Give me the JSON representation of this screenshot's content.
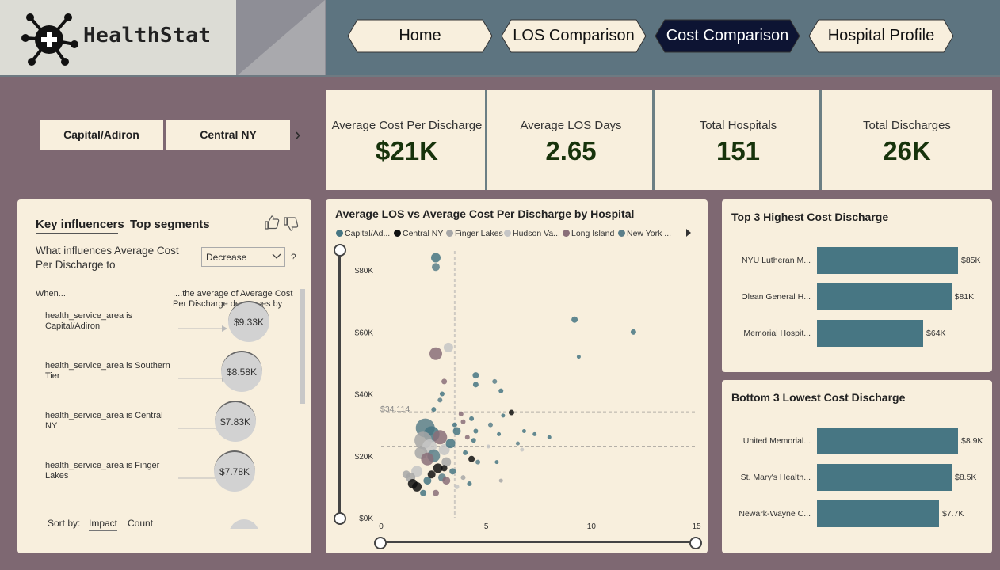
{
  "app": {
    "name": "HealthStat"
  },
  "nav": [
    {
      "label": "Home",
      "active": false
    },
    {
      "label": "LOS Comparison",
      "active": false
    },
    {
      "label": "Cost Comparison",
      "active": true
    },
    {
      "label": "Hospital Profile",
      "active": false
    }
  ],
  "slicer": {
    "items": [
      "Capital/Adiron",
      "Central NY"
    ],
    "next": "›"
  },
  "kpis": [
    {
      "label": "Average Cost Per Discharge",
      "value": "$21K"
    },
    {
      "label": "Average LOS Days",
      "value": "2.65"
    },
    {
      "label": "Total Hospitals",
      "value": "151"
    },
    {
      "label": "Total Discharges",
      "value": "26K"
    }
  ],
  "influencers": {
    "tabs": [
      "Key influencers",
      "Top segments"
    ],
    "question": "What influences Average Cost Per Discharge to",
    "dropdown": "Decrease",
    "help": "?",
    "col_when": "When...",
    "col_effect": "....the average of Average Cost Per Discharge decreases by",
    "items": [
      {
        "condition": "health_service_area is Capital/Adiron",
        "value": "$9.33K"
      },
      {
        "condition": "health_service_area is Southern Tier",
        "value": "$8.58K"
      },
      {
        "condition": "health_service_area is Central NY",
        "value": "$7.83K"
      },
      {
        "condition": "health_service_area is Finger Lakes",
        "value": "$7.78K"
      }
    ],
    "sort_label": "Sort by:",
    "sort_options": [
      "Impact",
      "Count"
    ]
  },
  "scatter": {
    "title": "Average LOS vs Average Cost Per Discharge by Hospital",
    "legend": [
      {
        "name": "Capital/Ad...",
        "color": "#477683"
      },
      {
        "name": "Central NY",
        "color": "#111111"
      },
      {
        "name": "Finger Lakes",
        "color": "#a7a7a7"
      },
      {
        "name": "Hudson Va...",
        "color": "#c6c6c6"
      },
      {
        "name": "Long Island",
        "color": "#8a6f79"
      },
      {
        "name": "New York ...",
        "color": "#5b7f8a"
      }
    ],
    "ref_label": "$34,114"
  },
  "chart_data": [
    {
      "type": "scatter",
      "title": "Average LOS vs Average Cost Per Discharge by Hospital",
      "xlabel": "",
      "ylabel": "",
      "xlim": [
        0,
        15
      ],
      "ylim": [
        0,
        90000
      ],
      "xticks": [
        "0",
        "5",
        "10",
        "15"
      ],
      "yticks": [
        "$0K",
        "$20K",
        "$40K",
        "$60K",
        "$80K"
      ],
      "reference_lines": {
        "y": [
          34114,
          23000
        ],
        "x": [
          3.5
        ]
      },
      "points": [
        {
          "x": 2.6,
          "y": 84000,
          "s": 6,
          "c": "#477683"
        },
        {
          "x": 2.6,
          "y": 81000,
          "s": 5,
          "c": "#5b7f8a"
        },
        {
          "x": 3.2,
          "y": 55000,
          "s": 6,
          "c": "#c6c6c6"
        },
        {
          "x": 2.6,
          "y": 53000,
          "s": 8,
          "c": "#8a6f79"
        },
        {
          "x": 9.2,
          "y": 64000,
          "s": 4,
          "c": "#477683"
        },
        {
          "x": 12.0,
          "y": 60000,
          "s": 3.5,
          "c": "#477683"
        },
        {
          "x": 9.4,
          "y": 52000,
          "s": 2.5,
          "c": "#477683"
        },
        {
          "x": 4.5,
          "y": 46000,
          "s": 4,
          "c": "#477683"
        },
        {
          "x": 4.5,
          "y": 43000,
          "s": 3.5,
          "c": "#477683"
        },
        {
          "x": 5.4,
          "y": 44000,
          "s": 3,
          "c": "#5b7f8a"
        },
        {
          "x": 5.7,
          "y": 41000,
          "s": 3,
          "c": "#477683"
        },
        {
          "x": 3.0,
          "y": 44000,
          "s": 3.5,
          "c": "#8a6f79"
        },
        {
          "x": 2.9,
          "y": 40000,
          "s": 3,
          "c": "#477683"
        },
        {
          "x": 2.8,
          "y": 38000,
          "s": 3,
          "c": "#5b7f8a"
        },
        {
          "x": 2.5,
          "y": 35000,
          "s": 3,
          "c": "#477683"
        },
        {
          "x": 6.2,
          "y": 34000,
          "s": 3.5,
          "c": "#111111"
        },
        {
          "x": 5.8,
          "y": 33000,
          "s": 2.5,
          "c": "#477683"
        },
        {
          "x": 4.3,
          "y": 32000,
          "s": 3,
          "c": "#477683"
        },
        {
          "x": 3.8,
          "y": 33500,
          "s": 3,
          "c": "#8a6f79"
        },
        {
          "x": 2.1,
          "y": 29000,
          "s": 12,
          "c": "#5b7f8a"
        },
        {
          "x": 2.4,
          "y": 27000,
          "s": 10,
          "c": "#477683"
        },
        {
          "x": 2.0,
          "y": 25000,
          "s": 11,
          "c": "#a7a7a7"
        },
        {
          "x": 2.8,
          "y": 26000,
          "s": 9,
          "c": "#8a6f79"
        },
        {
          "x": 2.3,
          "y": 23000,
          "s": 9,
          "c": "#c6c6c6"
        },
        {
          "x": 1.9,
          "y": 21000,
          "s": 8,
          "c": "#a7a7a7"
        },
        {
          "x": 2.5,
          "y": 20000,
          "s": 8,
          "c": "#5b7f8a"
        },
        {
          "x": 2.2,
          "y": 19000,
          "s": 8,
          "c": "#8a6f79"
        },
        {
          "x": 3.0,
          "y": 22000,
          "s": 7,
          "c": "#c6c6c6"
        },
        {
          "x": 3.3,
          "y": 24000,
          "s": 6,
          "c": "#477683"
        },
        {
          "x": 3.6,
          "y": 28000,
          "s": 5,
          "c": "#477683"
        },
        {
          "x": 3.1,
          "y": 18000,
          "s": 6,
          "c": "#a7a7a7"
        },
        {
          "x": 2.7,
          "y": 16000,
          "s": 6,
          "c": "#111111"
        },
        {
          "x": 1.7,
          "y": 15000,
          "s": 7,
          "c": "#c6c6c6"
        },
        {
          "x": 1.4,
          "y": 13000,
          "s": 6,
          "c": "#a7a7a7"
        },
        {
          "x": 1.5,
          "y": 11000,
          "s": 6,
          "c": "#111111"
        },
        {
          "x": 1.7,
          "y": 10000,
          "s": 6,
          "c": "#111111"
        },
        {
          "x": 2.2,
          "y": 12000,
          "s": 5,
          "c": "#477683"
        },
        {
          "x": 2.9,
          "y": 13000,
          "s": 5,
          "c": "#5b7f8a"
        },
        {
          "x": 2.4,
          "y": 14000,
          "s": 5,
          "c": "#111111"
        },
        {
          "x": 3.1,
          "y": 12000,
          "s": 5,
          "c": "#8a6f79"
        },
        {
          "x": 3.4,
          "y": 15000,
          "s": 4,
          "c": "#477683"
        },
        {
          "x": 1.2,
          "y": 14000,
          "s": 5,
          "c": "#a7a7a7"
        },
        {
          "x": 2.0,
          "y": 8000,
          "s": 4,
          "c": "#477683"
        },
        {
          "x": 2.6,
          "y": 8000,
          "s": 4,
          "c": "#8a6f79"
        },
        {
          "x": 3.0,
          "y": 16000,
          "s": 4,
          "c": "#111111"
        },
        {
          "x": 3.6,
          "y": 10000,
          "s": 3,
          "c": "#c6c6c6"
        },
        {
          "x": 3.9,
          "y": 13000,
          "s": 3,
          "c": "#a7a7a7"
        },
        {
          "x": 4.2,
          "y": 11000,
          "s": 3,
          "c": "#477683"
        },
        {
          "x": 4.3,
          "y": 19000,
          "s": 4,
          "c": "#111111"
        },
        {
          "x": 4.6,
          "y": 18000,
          "s": 3,
          "c": "#5b7f8a"
        },
        {
          "x": 4.0,
          "y": 21000,
          "s": 3,
          "c": "#477683"
        },
        {
          "x": 4.5,
          "y": 28000,
          "s": 3,
          "c": "#477683"
        },
        {
          "x": 4.1,
          "y": 26000,
          "s": 3,
          "c": "#8a6f79"
        },
        {
          "x": 5.2,
          "y": 30000,
          "s": 3,
          "c": "#5b7f8a"
        },
        {
          "x": 5.6,
          "y": 27000,
          "s": 2.5,
          "c": "#477683"
        },
        {
          "x": 5.1,
          "y": 23000,
          "s": 2.5,
          "c": "#c6c6c6"
        },
        {
          "x": 6.5,
          "y": 24000,
          "s": 2.5,
          "c": "#5b7f8a"
        },
        {
          "x": 6.8,
          "y": 28000,
          "s": 2.5,
          "c": "#477683"
        },
        {
          "x": 7.3,
          "y": 27000,
          "s": 2.5,
          "c": "#477683"
        },
        {
          "x": 8.0,
          "y": 26000,
          "s": 2.5,
          "c": "#477683"
        },
        {
          "x": 5.5,
          "y": 18000,
          "s": 2.5,
          "c": "#477683"
        },
        {
          "x": 5.7,
          "y": 12000,
          "s": 2.5,
          "c": "#a7a7a7"
        },
        {
          "x": 6.7,
          "y": 22000,
          "s": 2.5,
          "c": "#c6c6c6"
        },
        {
          "x": 3.5,
          "y": 30000,
          "s": 3,
          "c": "#477683"
        },
        {
          "x": 3.9,
          "y": 31000,
          "s": 3,
          "c": "#8a6f79"
        },
        {
          "x": 4.4,
          "y": 25000,
          "s": 3,
          "c": "#477683"
        }
      ]
    },
    {
      "type": "bar",
      "title": "Top 3 Highest Cost Discharge",
      "categories": [
        "NYU Lutheran M...",
        "Olean General H...",
        "Memorial Hospit..."
      ],
      "values": [
        85,
        81,
        64
      ],
      "value_labels": [
        "$85K",
        "$81K",
        "$64K"
      ],
      "xlim": [
        0,
        85
      ]
    },
    {
      "type": "bar",
      "title": "Bottom 3 Lowest Cost Discharge",
      "categories": [
        "United Memorial...",
        "St. Mary's Health...",
        "Newark-Wayne C..."
      ],
      "values": [
        8.9,
        8.5,
        7.7
      ],
      "value_labels": [
        "$8.9K",
        "$8.5K",
        "$7.7K"
      ],
      "xlim": [
        0,
        8.9
      ]
    }
  ]
}
